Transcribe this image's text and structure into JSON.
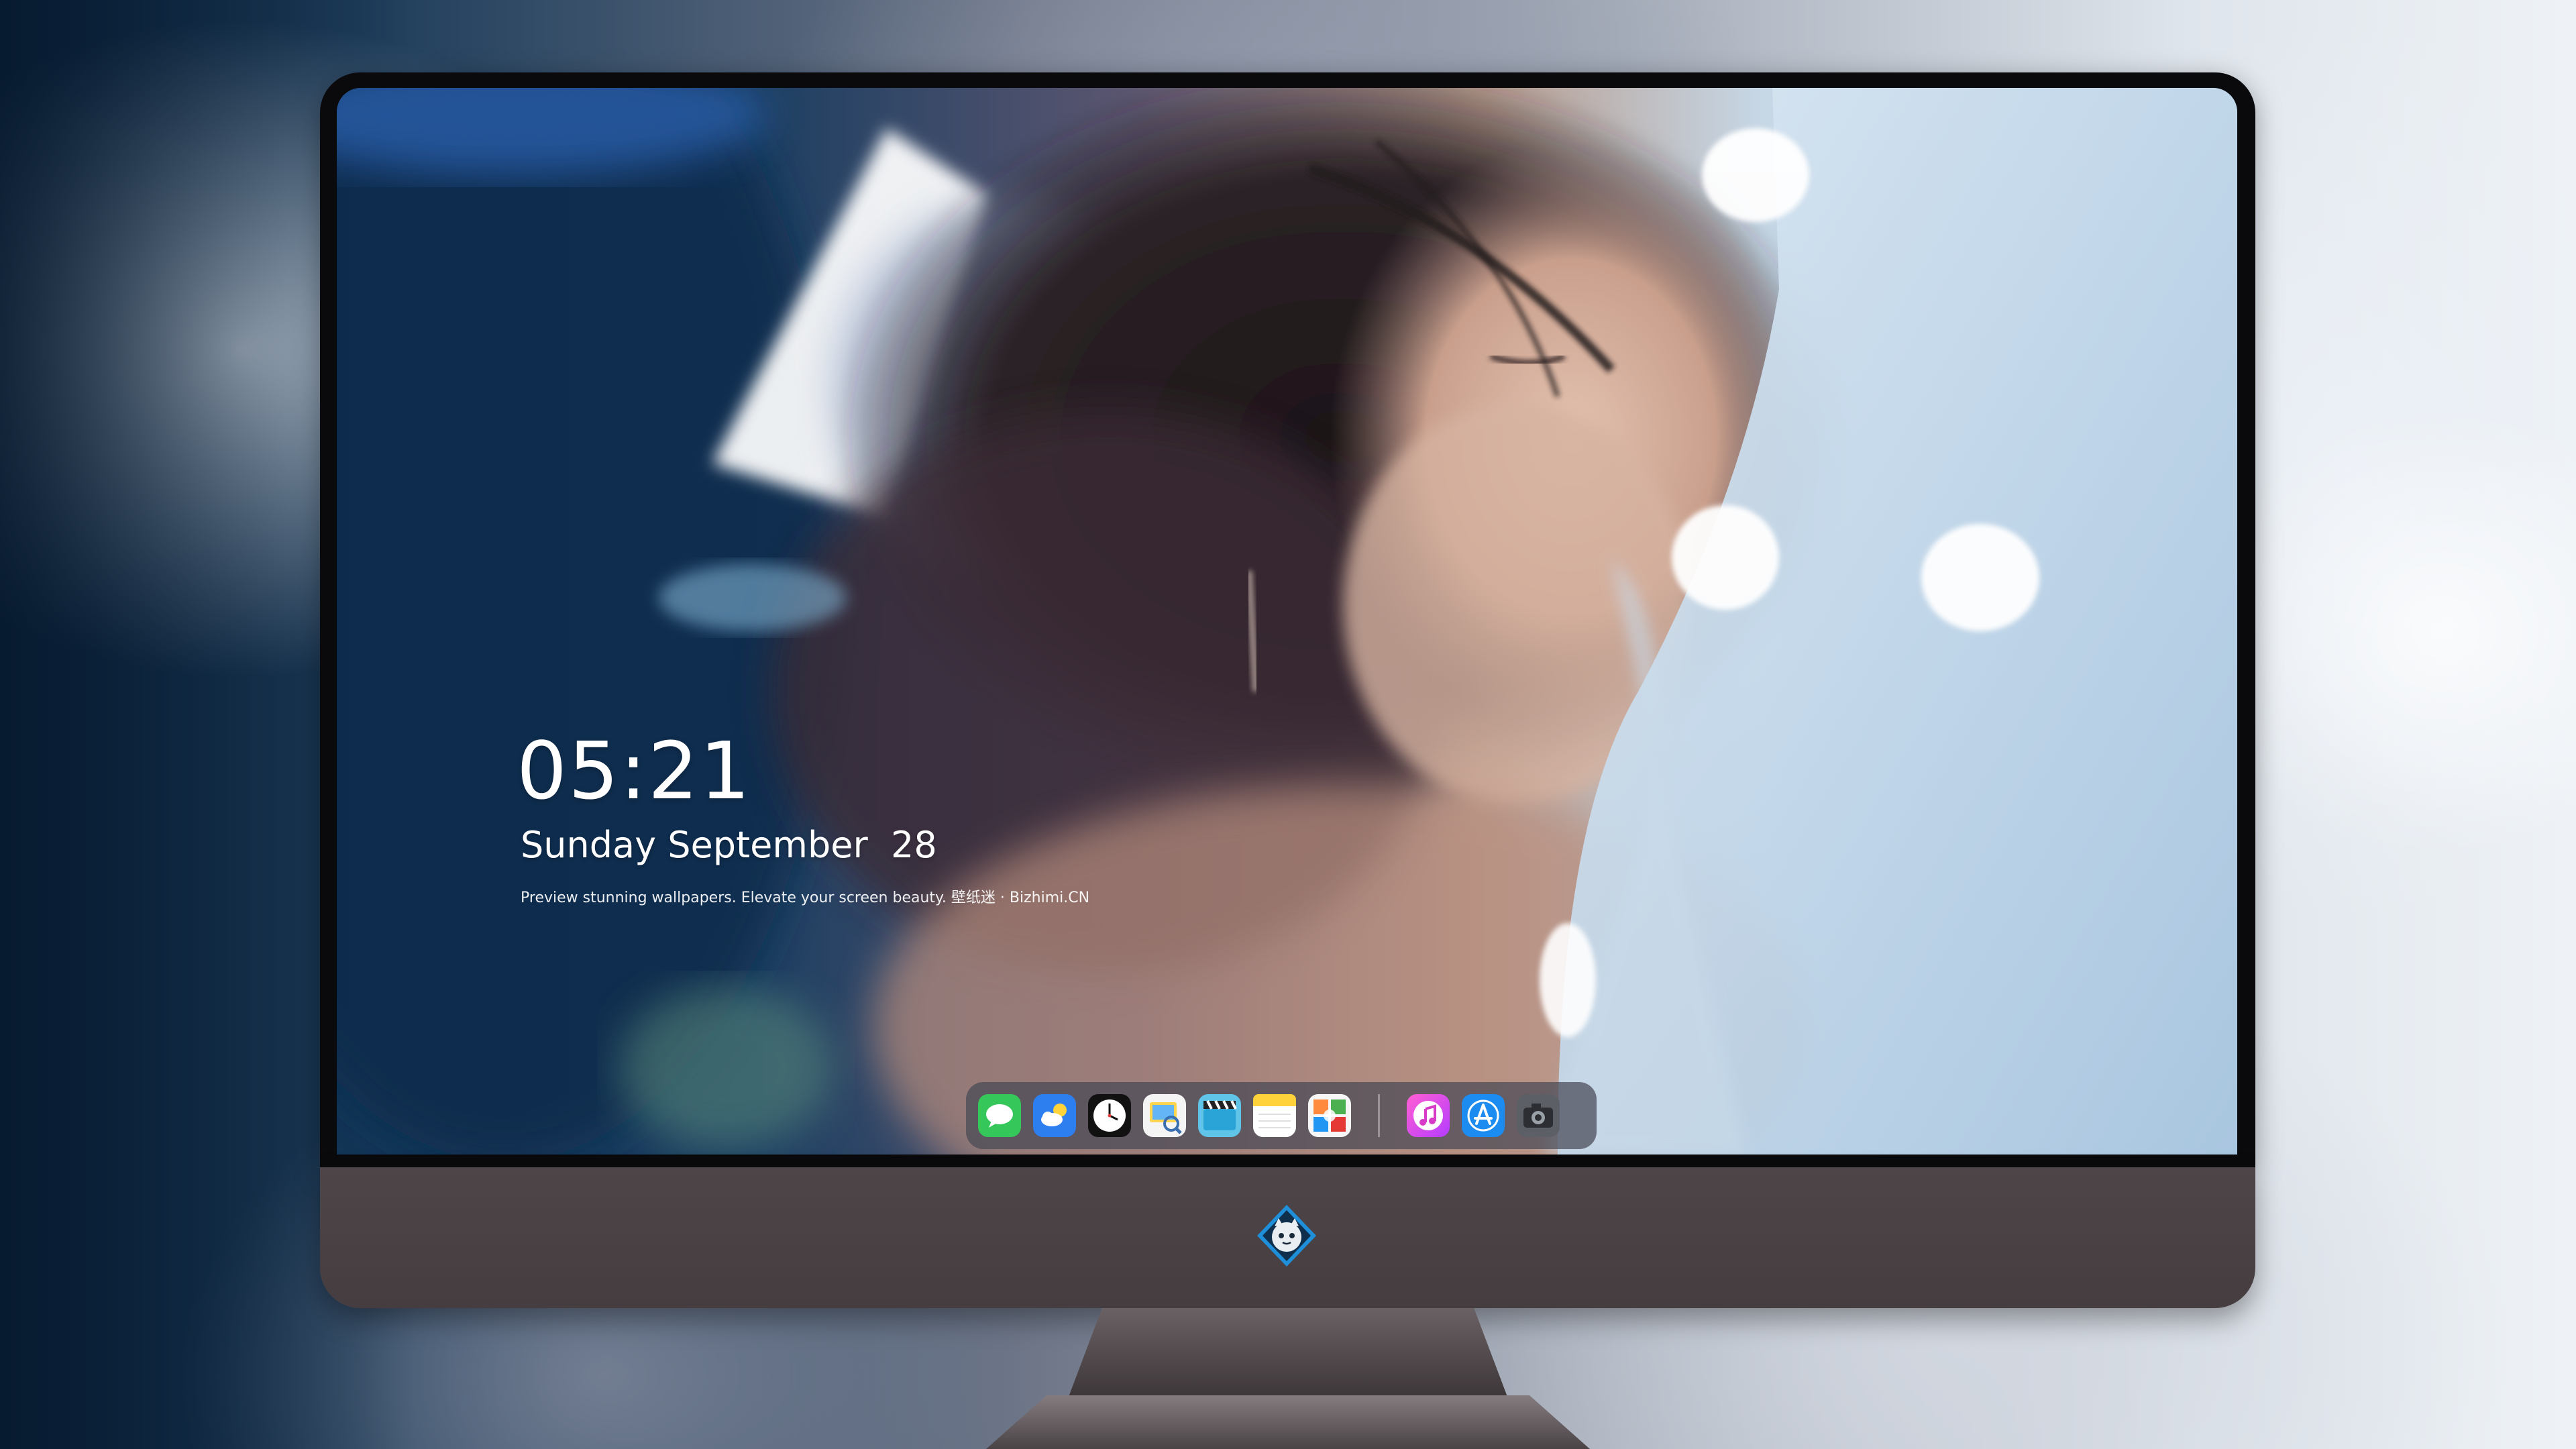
{
  "lock_screen": {
    "time": "05:21",
    "date": "Sunday September  28",
    "tagline": "Preview stunning wallpapers. Elevate your screen beauty. 壁纸迷 · Bizhimi.CN"
  },
  "dock": {
    "apps": [
      {
        "name": "messages-icon"
      },
      {
        "name": "weather-icon"
      },
      {
        "name": "clock-icon"
      },
      {
        "name": "preview-icon"
      },
      {
        "name": "video-clapper-icon"
      },
      {
        "name": "notes-icon"
      },
      {
        "name": "photo-gallery-icon"
      },
      {
        "name": "music-icon"
      },
      {
        "name": "app-store-icon"
      },
      {
        "name": "camera-icon"
      }
    ]
  },
  "colors": {
    "monitor_bezel": "#0a0a0c",
    "monitor_chin": "#4a4245",
    "dock_background": "#464854"
  }
}
